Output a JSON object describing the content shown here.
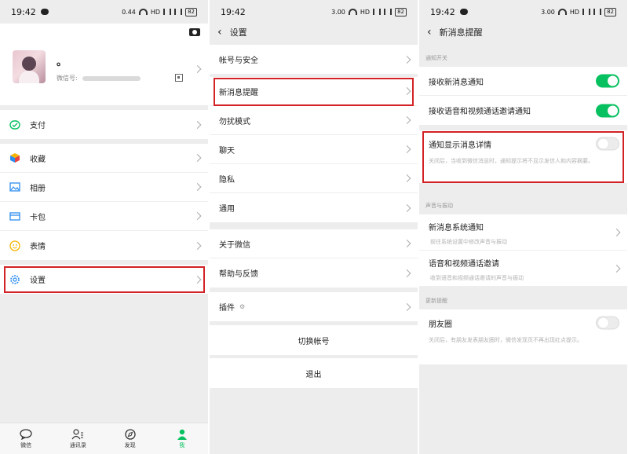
{
  "status": {
    "time": "19:42",
    "net_left": "0.44",
    "net_mid": "3.00",
    "net_right": "3.00",
    "hd": "HD",
    "battery": "82"
  },
  "panel1": {
    "nickname": "。",
    "wxid_label": "微信号:",
    "menu": [
      {
        "label": "支付",
        "icon": "wechat-pay-icon"
      },
      {
        "label": "收藏",
        "icon": "favorites-cube-icon"
      },
      {
        "label": "相册",
        "icon": "album-picture-icon"
      },
      {
        "label": "卡包",
        "icon": "card-wallet-icon"
      },
      {
        "label": "表情",
        "icon": "sticker-smile-icon"
      },
      {
        "label": "设置",
        "icon": "settings-gear-icon"
      }
    ],
    "tabs": [
      {
        "label": "微信",
        "icon": "chat-bubble-icon"
      },
      {
        "label": "通讯录",
        "icon": "contacts-icon"
      },
      {
        "label": "发现",
        "icon": "compass-icon"
      },
      {
        "label": "我",
        "icon": "me-person-icon"
      }
    ]
  },
  "panel2": {
    "title": "设置",
    "items": [
      "帐号与安全",
      "新消息提醒",
      "勿扰模式",
      "聊天",
      "隐私",
      "通用",
      "关于微信",
      "帮助与反馈",
      "插件"
    ],
    "switch_account": "切换帐号",
    "logout": "退出"
  },
  "panel3": {
    "title": "新消息提醒",
    "section_notify": "通知开关",
    "recv_new": "接收新消息通知",
    "recv_voice": "接收语音和视频通话邀请通知",
    "show_detail": "通知显示消息详情",
    "show_detail_desc": "关闭后，当收到微信消息时，通知提示将不显示发信人和内容摘要。",
    "section_sound": "声音与振动",
    "new_msg_sound": "新消息系统通知",
    "new_msg_sound_desc": "前往系统设置中修改声音与振动",
    "voice_ringtone": "语音和视频通话邀请",
    "voice_ringtone_desc": "收到语音和视频通话邀请的声音与振动",
    "section_update": "更新提醒",
    "moments": "朋友圈",
    "moments_desc": "关闭后，有朋友发表朋友圈时，微信发现页不再出现红点提示。"
  },
  "colors": {
    "accent": "#07c160",
    "highlight": "#d32226"
  }
}
